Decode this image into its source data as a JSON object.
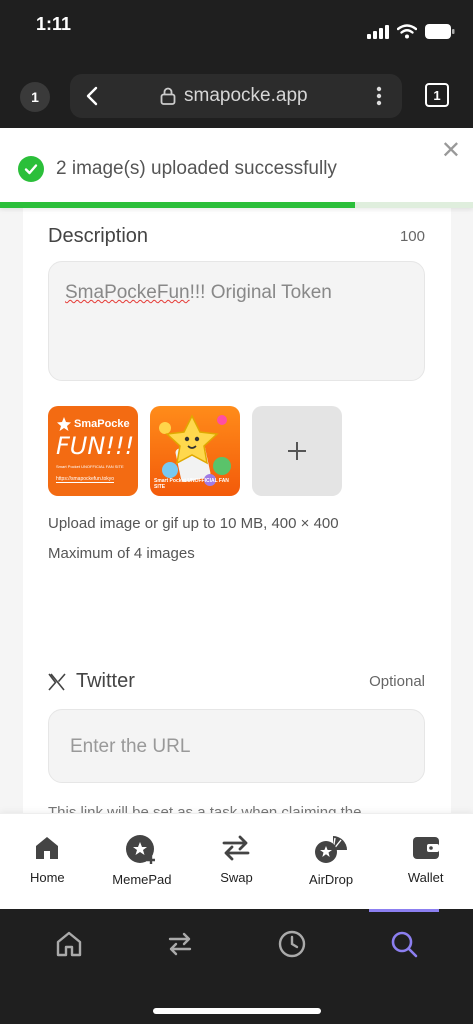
{
  "status": {
    "time": "1:11"
  },
  "browser": {
    "tabs_left": "1",
    "url": "smapocke.app",
    "tabs_right": "1"
  },
  "toast": {
    "message": "2 image(s) uploaded successfully",
    "progress": 0.75
  },
  "description": {
    "label": "Description",
    "count": "100",
    "value_part1": "SmaPockeFun",
    "value_part2": "!!! Original Token"
  },
  "images": {
    "thumb1_brand_line1": "SmaPocke",
    "thumb1_brand_line2": "FUN!!!",
    "thumb1_sub": "Smart Pocket UNOFFICIAL FAN SITE",
    "thumb1_url": "https://smapockefun.tokyo",
    "thumb2_caption": "Smart Pocket UNOFFICIAL FAN SITE",
    "upload_hint": "Upload image or gif up to 10 MB, 400 × 400",
    "max_hint": "Maximum of 4 images"
  },
  "twitter": {
    "label": "Twitter",
    "optional": "Optional",
    "placeholder": "Enter the URL",
    "hint_cut": "This link will be set as a task when claiming the"
  },
  "app_nav": [
    {
      "label": "Home",
      "icon": "home-icon"
    },
    {
      "label": "MemePad",
      "icon": "memepad-icon"
    },
    {
      "label": "Swap",
      "icon": "swap-icon"
    },
    {
      "label": "AirDrop",
      "icon": "airdrop-icon"
    },
    {
      "label": "Wallet",
      "icon": "wallet-icon"
    }
  ],
  "colors": {
    "success": "#2bbf3a",
    "active": "#8c7ff0"
  }
}
